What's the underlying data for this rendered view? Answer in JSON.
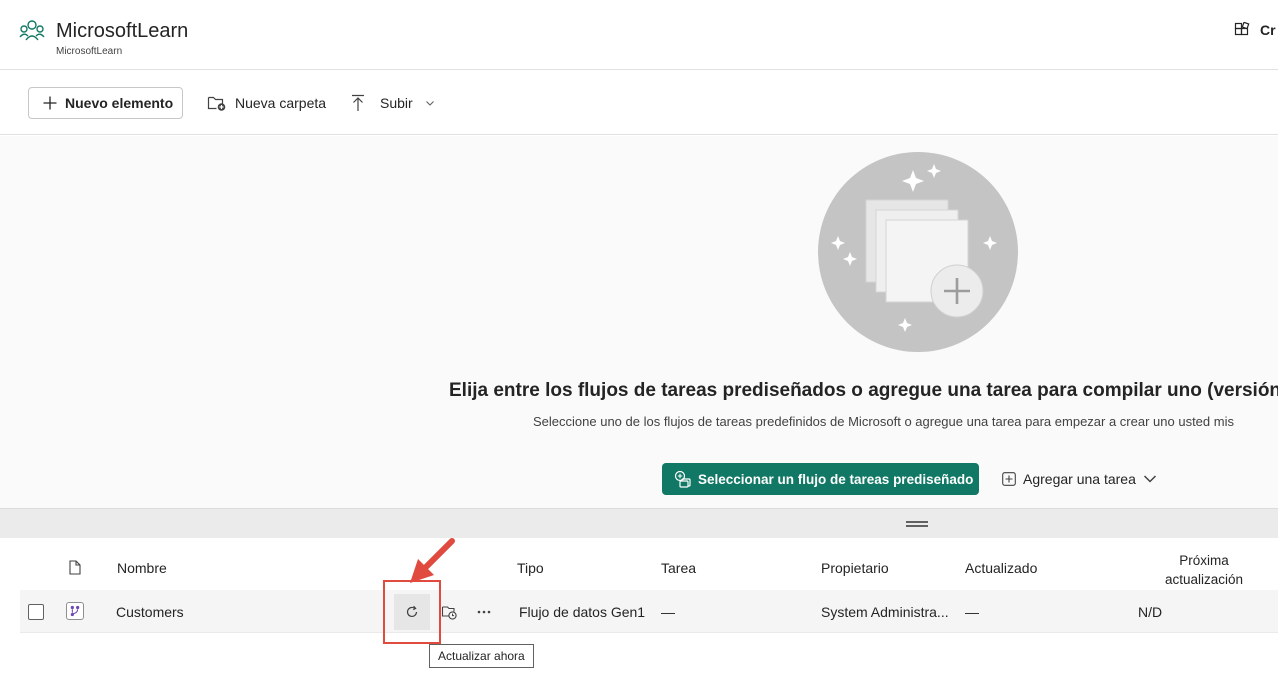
{
  "header": {
    "workspace_title": "MicrosoftLearn",
    "workspace_subtitle": "MicrosoftLearn",
    "right_label": "Cr"
  },
  "toolbar": {
    "new_item_label": "Nuevo elemento",
    "new_folder_label": "Nueva carpeta",
    "upload_label": "Subir"
  },
  "empty_state": {
    "title": "Elija entre los flujos de tareas prediseñados o agregue una tarea para compilar uno (versión",
    "subtitle": "Seleccione uno de los flujos de tareas predefinidos de Microsoft o agregue una tarea para empezar a crear uno usted mis",
    "primary_button_label": "Seleccionar un flujo de tareas prediseñado",
    "add_task_label": "Agregar una tarea"
  },
  "list": {
    "columns": {
      "name": "Nombre",
      "type": "Tipo",
      "task": "Tarea",
      "owner": "Propietario",
      "updated": "Actualizado",
      "next_refresh_line1": "Próxima",
      "next_refresh_line2": "actualización"
    },
    "rows": [
      {
        "name": "Customers",
        "type": "Flujo de datos Gen1",
        "task": "—",
        "owner": "System Administra...",
        "updated": "—",
        "next_refresh": "N/D"
      }
    ]
  },
  "tooltip": {
    "refresh_now": "Actualizar ahora"
  },
  "colors": {
    "primary": "#117865",
    "annotation": "#e04a3f"
  }
}
